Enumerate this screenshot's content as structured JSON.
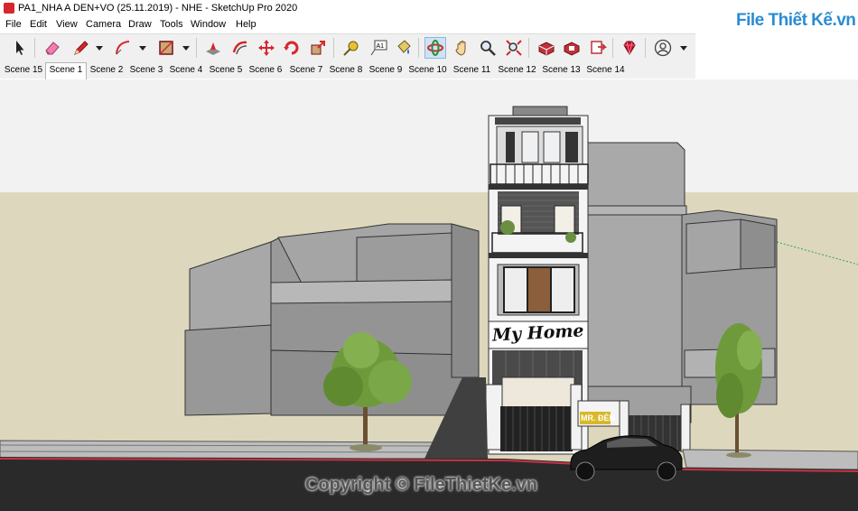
{
  "window": {
    "title": "PA1_NHA A DEN+VO (25.11.2019) - NHE - SketchUp Pro 2020"
  },
  "menu": [
    "File",
    "Edit",
    "View",
    "Camera",
    "Draw",
    "Tools",
    "Window",
    "Help"
  ],
  "toolbar": {
    "tools": [
      {
        "name": "select-tool",
        "icon": "arrow-cursor-icon"
      },
      {
        "name": "eraser-tool",
        "icon": "eraser-icon"
      },
      {
        "name": "line-tool",
        "icon": "pencil-icon"
      },
      {
        "name": "arc-tool",
        "icon": "arc-icon"
      },
      {
        "name": "shape-tool",
        "icon": "rectangle-icon"
      },
      {
        "name": "push-pull-tool",
        "icon": "push-pull-icon"
      },
      {
        "name": "offset-tool",
        "icon": "offset-icon"
      },
      {
        "name": "move-tool",
        "icon": "move-icon"
      },
      {
        "name": "rotate-tool",
        "icon": "rotate-icon"
      },
      {
        "name": "scale-tool",
        "icon": "scale-icon"
      },
      {
        "name": "tape-measure-tool",
        "icon": "tape-measure-icon"
      },
      {
        "name": "text-tool",
        "icon": "text-icon"
      },
      {
        "name": "paint-bucket-tool",
        "icon": "paint-bucket-icon"
      },
      {
        "name": "orbit-tool",
        "icon": "orbit-icon"
      },
      {
        "name": "pan-tool",
        "icon": "hand-icon"
      },
      {
        "name": "zoom-tool",
        "icon": "magnifier-icon"
      },
      {
        "name": "zoom-extents-tool",
        "icon": "zoom-extents-icon"
      },
      {
        "name": "warehouse-tool",
        "icon": "warehouse-icon"
      },
      {
        "name": "extension-warehouse-tool",
        "icon": "extension-icon"
      },
      {
        "name": "send-to-layout-tool",
        "icon": "layout-icon"
      },
      {
        "name": "ruby-console-tool",
        "icon": "ruby-icon"
      },
      {
        "name": "account-tool",
        "icon": "account-icon"
      }
    ],
    "text_tool_label": "A1"
  },
  "scenes": {
    "tabs": [
      "Scene 15",
      "Scene 1",
      "Scene 2",
      "Scene 3",
      "Scene 4",
      "Scene 5",
      "Scene 6",
      "Scene 7",
      "Scene 8",
      "Scene 9",
      "Scene 10",
      "Scene 11",
      "Scene 12",
      "Scene 13",
      "Scene 14"
    ],
    "active": "Scene 1"
  },
  "viewport": {
    "sign_text": "My Home",
    "shop_sign": "MR. ĐÈN",
    "sky_color": "#f2f2f2",
    "ground_color": "#ddd8bd",
    "road_color": "#2a2a2a"
  },
  "watermark": {
    "logo_text": "File Thiết Kế.vn",
    "copyright": "Copyright © FileThietKe.vn"
  }
}
